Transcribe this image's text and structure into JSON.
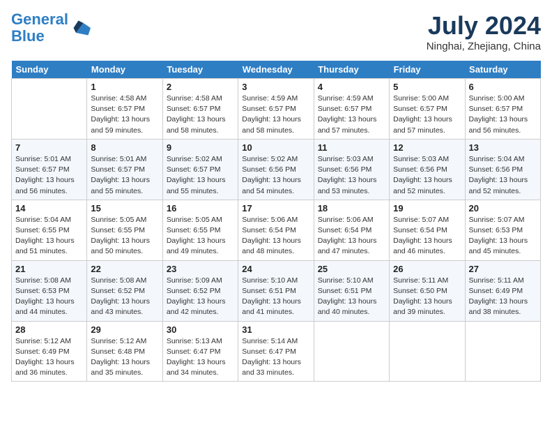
{
  "header": {
    "logo_line1": "General",
    "logo_line2": "Blue",
    "month": "July 2024",
    "location": "Ninghai, Zhejiang, China"
  },
  "weekdays": [
    "Sunday",
    "Monday",
    "Tuesday",
    "Wednesday",
    "Thursday",
    "Friday",
    "Saturday"
  ],
  "weeks": [
    [
      {
        "day": "",
        "info": ""
      },
      {
        "day": "1",
        "info": "Sunrise: 4:58 AM\nSunset: 6:57 PM\nDaylight: 13 hours\nand 59 minutes."
      },
      {
        "day": "2",
        "info": "Sunrise: 4:58 AM\nSunset: 6:57 PM\nDaylight: 13 hours\nand 58 minutes."
      },
      {
        "day": "3",
        "info": "Sunrise: 4:59 AM\nSunset: 6:57 PM\nDaylight: 13 hours\nand 58 minutes."
      },
      {
        "day": "4",
        "info": "Sunrise: 4:59 AM\nSunset: 6:57 PM\nDaylight: 13 hours\nand 57 minutes."
      },
      {
        "day": "5",
        "info": "Sunrise: 5:00 AM\nSunset: 6:57 PM\nDaylight: 13 hours\nand 57 minutes."
      },
      {
        "day": "6",
        "info": "Sunrise: 5:00 AM\nSunset: 6:57 PM\nDaylight: 13 hours\nand 56 minutes."
      }
    ],
    [
      {
        "day": "7",
        "info": "Sunrise: 5:01 AM\nSunset: 6:57 PM\nDaylight: 13 hours\nand 56 minutes."
      },
      {
        "day": "8",
        "info": "Sunrise: 5:01 AM\nSunset: 6:57 PM\nDaylight: 13 hours\nand 55 minutes."
      },
      {
        "day": "9",
        "info": "Sunrise: 5:02 AM\nSunset: 6:57 PM\nDaylight: 13 hours\nand 55 minutes."
      },
      {
        "day": "10",
        "info": "Sunrise: 5:02 AM\nSunset: 6:56 PM\nDaylight: 13 hours\nand 54 minutes."
      },
      {
        "day": "11",
        "info": "Sunrise: 5:03 AM\nSunset: 6:56 PM\nDaylight: 13 hours\nand 53 minutes."
      },
      {
        "day": "12",
        "info": "Sunrise: 5:03 AM\nSunset: 6:56 PM\nDaylight: 13 hours\nand 52 minutes."
      },
      {
        "day": "13",
        "info": "Sunrise: 5:04 AM\nSunset: 6:56 PM\nDaylight: 13 hours\nand 52 minutes."
      }
    ],
    [
      {
        "day": "14",
        "info": "Sunrise: 5:04 AM\nSunset: 6:55 PM\nDaylight: 13 hours\nand 51 minutes."
      },
      {
        "day": "15",
        "info": "Sunrise: 5:05 AM\nSunset: 6:55 PM\nDaylight: 13 hours\nand 50 minutes."
      },
      {
        "day": "16",
        "info": "Sunrise: 5:05 AM\nSunset: 6:55 PM\nDaylight: 13 hours\nand 49 minutes."
      },
      {
        "day": "17",
        "info": "Sunrise: 5:06 AM\nSunset: 6:54 PM\nDaylight: 13 hours\nand 48 minutes."
      },
      {
        "day": "18",
        "info": "Sunrise: 5:06 AM\nSunset: 6:54 PM\nDaylight: 13 hours\nand 47 minutes."
      },
      {
        "day": "19",
        "info": "Sunrise: 5:07 AM\nSunset: 6:54 PM\nDaylight: 13 hours\nand 46 minutes."
      },
      {
        "day": "20",
        "info": "Sunrise: 5:07 AM\nSunset: 6:53 PM\nDaylight: 13 hours\nand 45 minutes."
      }
    ],
    [
      {
        "day": "21",
        "info": "Sunrise: 5:08 AM\nSunset: 6:53 PM\nDaylight: 13 hours\nand 44 minutes."
      },
      {
        "day": "22",
        "info": "Sunrise: 5:08 AM\nSunset: 6:52 PM\nDaylight: 13 hours\nand 43 minutes."
      },
      {
        "day": "23",
        "info": "Sunrise: 5:09 AM\nSunset: 6:52 PM\nDaylight: 13 hours\nand 42 minutes."
      },
      {
        "day": "24",
        "info": "Sunrise: 5:10 AM\nSunset: 6:51 PM\nDaylight: 13 hours\nand 41 minutes."
      },
      {
        "day": "25",
        "info": "Sunrise: 5:10 AM\nSunset: 6:51 PM\nDaylight: 13 hours\nand 40 minutes."
      },
      {
        "day": "26",
        "info": "Sunrise: 5:11 AM\nSunset: 6:50 PM\nDaylight: 13 hours\nand 39 minutes."
      },
      {
        "day": "27",
        "info": "Sunrise: 5:11 AM\nSunset: 6:49 PM\nDaylight: 13 hours\nand 38 minutes."
      }
    ],
    [
      {
        "day": "28",
        "info": "Sunrise: 5:12 AM\nSunset: 6:49 PM\nDaylight: 13 hours\nand 36 minutes."
      },
      {
        "day": "29",
        "info": "Sunrise: 5:12 AM\nSunset: 6:48 PM\nDaylight: 13 hours\nand 35 minutes."
      },
      {
        "day": "30",
        "info": "Sunrise: 5:13 AM\nSunset: 6:47 PM\nDaylight: 13 hours\nand 34 minutes."
      },
      {
        "day": "31",
        "info": "Sunrise: 5:14 AM\nSunset: 6:47 PM\nDaylight: 13 hours\nand 33 minutes."
      },
      {
        "day": "",
        "info": ""
      },
      {
        "day": "",
        "info": ""
      },
      {
        "day": "",
        "info": ""
      }
    ]
  ]
}
